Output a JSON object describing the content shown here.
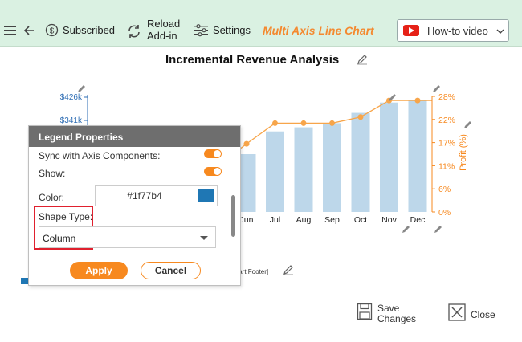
{
  "toolbar": {
    "subscribed_label": "Subscribed",
    "reload_label_line1": "Reload",
    "reload_label_line2": "Add-in",
    "settings_label": "Settings",
    "chart_name": "Multi Axis Line Chart",
    "howto_label": "How-to video"
  },
  "chart": {
    "title": "Incremental Revenue Analysis",
    "left_axis_ticks": [
      "$426k",
      "$341k"
    ],
    "footer_placeholder": "Chart Footer]",
    "right_axis_label": "Profit (%)"
  },
  "chart_data": {
    "type": "bar",
    "title": "Incremental Revenue Analysis",
    "categories": [
      "Jun",
      "Jul",
      "Aug",
      "Sep",
      "Oct",
      "Nov",
      "Dec"
    ],
    "series": [
      {
        "type": "bar",
        "values": [
          14,
          19.5,
          20.5,
          21.5,
          24,
          26.5,
          27
        ]
      },
      {
        "type": "line",
        "axis": "right",
        "values": [
          16.5,
          21.5,
          21.5,
          21.5,
          23,
          27,
          27
        ]
      }
    ],
    "ylim": [
      0,
      28
    ],
    "right_ylim": [
      0,
      28
    ],
    "right_ylabel": "Profit (%)",
    "right_ticks": [
      "28%",
      "22%",
      "17%",
      "11%",
      "6%",
      "0%"
    ],
    "right_tick_values": [
      28,
      22.4,
      16.8,
      11.2,
      5.6,
      0
    ],
    "bar_color": "#bdd7ea",
    "line_color": "#f7a54a",
    "axis_color": "#f7891f"
  },
  "dialog": {
    "title": "Legend Properties",
    "sync_label": "Sync with Axis Components:",
    "show_label": "Show:",
    "color_label": "Color:",
    "color_value": "#1f77b4",
    "shape_type_label": "Shape Type:",
    "shape_type_value": "Column",
    "apply_label": "Apply",
    "cancel_label": "Cancel"
  },
  "bottom": {
    "save_line1": "Save",
    "save_line2": "Changes",
    "close_label": "Close"
  },
  "icons": {
    "menu": "menu-icon",
    "back": "back-arrow-icon",
    "subscribed": "dollar-circle-icon",
    "reload": "reload-icon",
    "settings": "sliders-icon",
    "youtube": "youtube-icon",
    "edit": "pencil-icon",
    "save": "save-icon",
    "close": "close-icon"
  }
}
